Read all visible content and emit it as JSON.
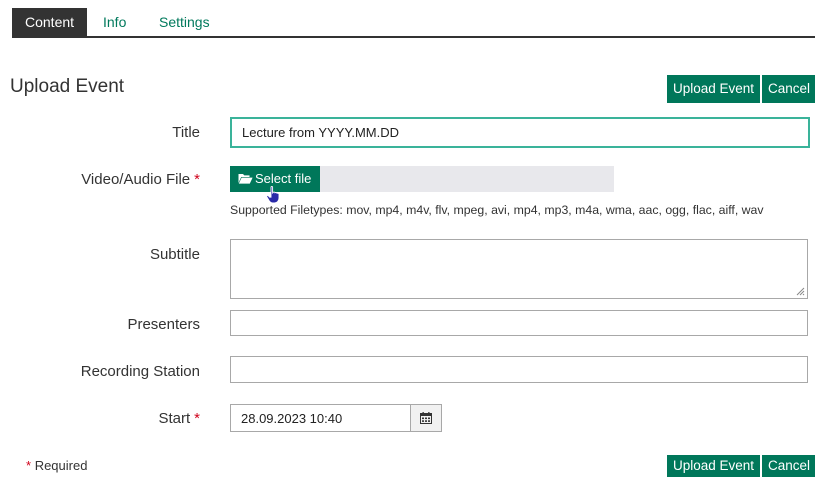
{
  "tabs": {
    "content": "Content",
    "info": "Info",
    "settings": "Settings"
  },
  "header": {
    "title": "Upload Event",
    "upload_label": "Upload Event",
    "cancel_label": "Cancel"
  },
  "form": {
    "title": {
      "label": "Title",
      "value": "Lecture from YYYY.MM.DD"
    },
    "file": {
      "label": "Video/Audio File",
      "required_mark": "*",
      "button_label": "Select file",
      "supported_types": "Supported Filetypes: mov, mp4, m4v, flv, mpeg, avi, mp4, mp3, m4a, wma, aac, ogg, flac, aiff, wav"
    },
    "subtitle": {
      "label": "Subtitle",
      "value": ""
    },
    "presenters": {
      "label": "Presenters",
      "value": ""
    },
    "recording_station": {
      "label": "Recording Station",
      "value": ""
    },
    "start": {
      "label": "Start",
      "required_mark": "*",
      "value": "28.09.2023 10:40"
    }
  },
  "footer": {
    "required_note": "Required",
    "required_mark": "*",
    "upload_label": "Upload Event",
    "cancel_label": "Cancel"
  },
  "icons": {
    "folder": "folder-open-icon",
    "calendar": "calendar-icon",
    "cursor": "hand-pointer-icon"
  },
  "colors": {
    "accent": "#00775a",
    "tab_active_bg": "#333333",
    "focus_border": "#3ab39a",
    "required_star": "#d0021b"
  }
}
